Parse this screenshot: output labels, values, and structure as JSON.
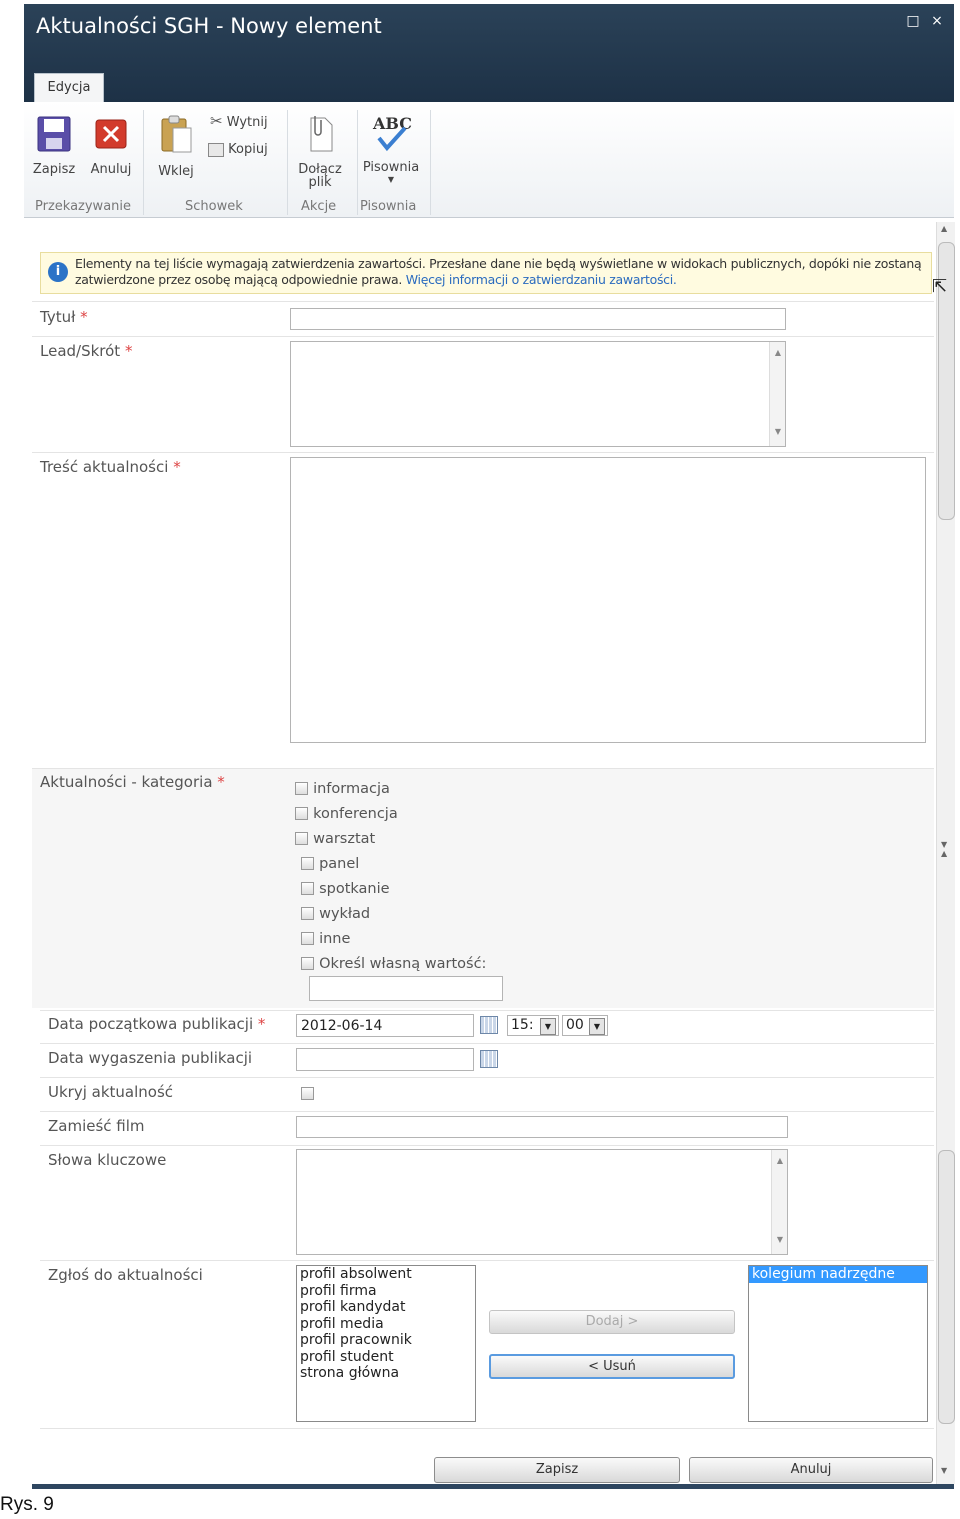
{
  "window": {
    "title": "Aktualności SGH - Nowy element",
    "maximize_glyph": "□",
    "close_glyph": "×",
    "tab": "Edycja"
  },
  "ribbon": {
    "save": "Zapisz",
    "cancel": "Anuluj",
    "paste": "Wklej",
    "cut": "Wytnij",
    "copy": "Kopiuj",
    "attach_line1": "Dołącz",
    "attach_line2": "plik",
    "spelling": "Pisownia",
    "spelling_icon_text": "ABC",
    "groups": {
      "commit": "Przekazywanie",
      "clipboard": "Schowek",
      "actions": "Akcje",
      "spelling": "Pisownia"
    }
  },
  "info": {
    "text": "Elementy na tej liście wymagają zatwierdzenia zawartości. Przesłane dane nie będą wyświetlane w widokach publicznych, dopóki nie zostaną zatwierdzone przez osobę mającą odpowiednie prawa.",
    "link": "Więcej informacji o zatwierdzaniu zawartości."
  },
  "form": {
    "required_mark": "*",
    "title_label": "Tytuł",
    "lead_label": "Lead/Skrót",
    "content_label": "Treść aktualności",
    "category_label": "Aktualności - kategoria",
    "categories": [
      "informacja",
      "konferencja",
      "warsztat",
      "panel",
      "spotkanie",
      "wykład",
      "inne",
      "Określ własną wartość:"
    ],
    "start_date_label": "Data początkowa publikacji",
    "start_date_value": "2012-06-14",
    "start_hour": "15:",
    "start_minute": "00",
    "expiry_label": "Data wygaszenia publikacji",
    "hide_label": "Ukryj aktualność",
    "film_label": "Zamieść film",
    "keywords_label": "Słowa kluczowe",
    "submit_label": "Zgłoś do aktualności",
    "available_options": [
      "profil absolwent",
      "profil firma",
      "profil kandydat",
      "profil media",
      "profil pracownik",
      "profil student",
      "strona główna"
    ],
    "selected_options": [
      "kolegium nadrzędne"
    ],
    "add_button": "Dodaj >",
    "remove_button": "< Usuń"
  },
  "footer": {
    "save": "Zapisz",
    "cancel": "Anuluj"
  },
  "caption": "Rys. 9"
}
